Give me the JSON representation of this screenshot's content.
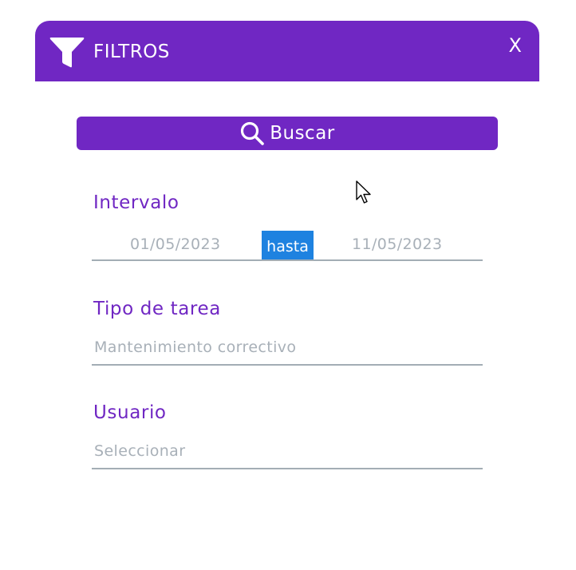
{
  "dialog": {
    "title": "FILTROS",
    "close_label": "X",
    "icons": {
      "header": "filter-icon",
      "search": "search-icon"
    },
    "colors": {
      "accent": "#7027c3",
      "highlight": "#1e82e0",
      "placeholder": "#a8b0b8"
    }
  },
  "search_button": {
    "label": "Buscar"
  },
  "interval": {
    "label": "Intervalo",
    "start": "01/05/2023",
    "separator": "hasta",
    "end": "11/05/2023"
  },
  "task_type": {
    "label": "Tipo de tarea",
    "value": "Mantenimiento correctivo"
  },
  "user": {
    "label": "Usuario",
    "value": "Seleccionar"
  }
}
